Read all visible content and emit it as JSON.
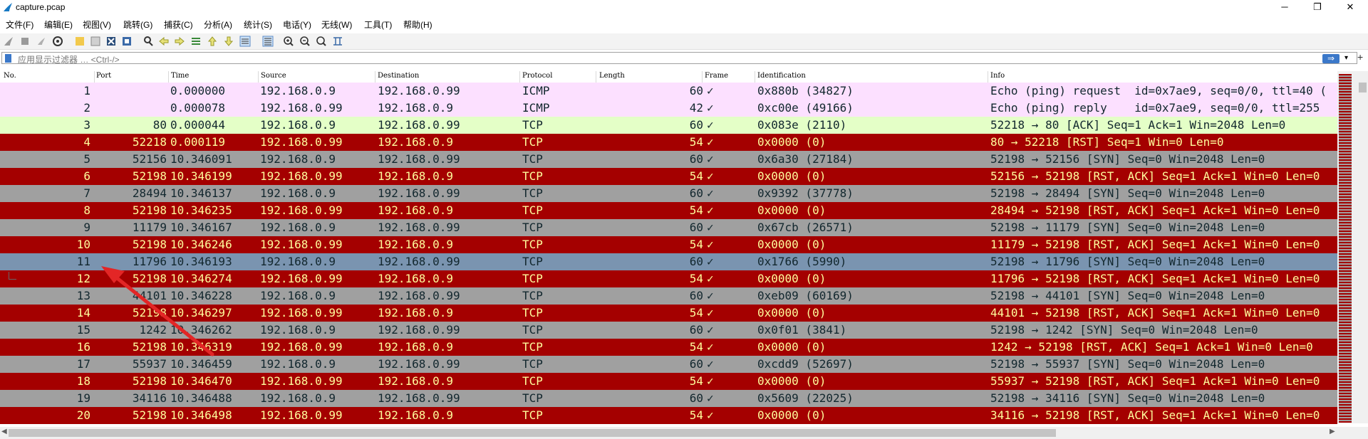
{
  "window": {
    "title": "capture.pcap",
    "minimize": "─",
    "maximize": "❐",
    "close": "✕"
  },
  "menu": [
    "文件(F)",
    "编辑(E)",
    "视图(V)",
    "跳转(G)",
    "捕获(C)",
    "分析(A)",
    "统计(S)",
    "电话(Y)",
    "无线(W)",
    "工具(T)",
    "帮助(H)"
  ],
  "filter": {
    "placeholder": "应用显示过滤器 … <Ctrl-/>",
    "apply": "⇒",
    "dropdown": "▾",
    "add": "+"
  },
  "columns": {
    "no": "No.",
    "port": "Port",
    "time": "Time",
    "source": "Source",
    "destination": "Destination",
    "protocol": "Protocol",
    "length": "Length",
    "frame": "Frame",
    "identification": "Identification",
    "info": "Info"
  },
  "colors": {
    "icmp_bg": "#fce0ff",
    "ack_bg": "#e4ffc7",
    "rst_bg": "#a40000",
    "rst_fg": "#fffc9c",
    "syn_bg": "#a0a0a0",
    "selected_bg": "#7a94b0",
    "arrow": "#e32626"
  },
  "packets": [
    {
      "no": "1",
      "port": "",
      "time": "0.000000",
      "src": "192.168.0.9",
      "dst": "192.168.0.99",
      "proto": "ICMP",
      "len": "60",
      "frame": "✓",
      "id": "0x880b (34827)",
      "info": "Echo (ping) request  id=0x7ae9, seq=0/0, ttl=40 (",
      "style": "icmp"
    },
    {
      "no": "2",
      "port": "",
      "time": "0.000078",
      "src": "192.168.0.99",
      "dst": "192.168.0.9",
      "proto": "ICMP",
      "len": "42",
      "frame": "✓",
      "id": "0xc00e (49166)",
      "info": "Echo (ping) reply    id=0x7ae9, seq=0/0, ttl=255",
      "style": "icmp"
    },
    {
      "no": "3",
      "port": "80",
      "time": "0.000044",
      "src": "192.168.0.9",
      "dst": "192.168.0.99",
      "proto": "TCP",
      "len": "60",
      "frame": "✓",
      "id": "0x083e (2110)",
      "info": "52218 → 80 [ACK] Seq=1 Ack=1 Win=2048 Len=0",
      "style": "ack"
    },
    {
      "no": "4",
      "port": "52218",
      "time": "0.000119",
      "src": "192.168.0.99",
      "dst": "192.168.0.9",
      "proto": "TCP",
      "len": "54",
      "frame": "✓",
      "id": "0x0000 (0)",
      "info": "80 → 52218 [RST] Seq=1 Win=0 Len=0",
      "style": "rst"
    },
    {
      "no": "5",
      "port": "52156",
      "time": "10.346091",
      "src": "192.168.0.9",
      "dst": "192.168.0.99",
      "proto": "TCP",
      "len": "60",
      "frame": "✓",
      "id": "0x6a30 (27184)",
      "info": "52198 → 52156 [SYN] Seq=0 Win=2048 Len=0",
      "style": "syn"
    },
    {
      "no": "6",
      "port": "52198",
      "time": "10.346199",
      "src": "192.168.0.99",
      "dst": "192.168.0.9",
      "proto": "TCP",
      "len": "54",
      "frame": "✓",
      "id": "0x0000 (0)",
      "info": "52156 → 52198 [RST, ACK] Seq=1 Ack=1 Win=0 Len=0",
      "style": "rst"
    },
    {
      "no": "7",
      "port": "28494",
      "time": "10.346137",
      "src": "192.168.0.9",
      "dst": "192.168.0.99",
      "proto": "TCP",
      "len": "60",
      "frame": "✓",
      "id": "0x9392 (37778)",
      "info": "52198 → 28494 [SYN] Seq=0 Win=2048 Len=0",
      "style": "syn"
    },
    {
      "no": "8",
      "port": "52198",
      "time": "10.346235",
      "src": "192.168.0.99",
      "dst": "192.168.0.9",
      "proto": "TCP",
      "len": "54",
      "frame": "✓",
      "id": "0x0000 (0)",
      "info": "28494 → 52198 [RST, ACK] Seq=1 Ack=1 Win=0 Len=0",
      "style": "rst"
    },
    {
      "no": "9",
      "port": "11179",
      "time": "10.346167",
      "src": "192.168.0.9",
      "dst": "192.168.0.99",
      "proto": "TCP",
      "len": "60",
      "frame": "✓",
      "id": "0x67cb (26571)",
      "info": "52198 → 11179 [SYN] Seq=0 Win=2048 Len=0",
      "style": "syn"
    },
    {
      "no": "10",
      "port": "52198",
      "time": "10.346246",
      "src": "192.168.0.99",
      "dst": "192.168.0.9",
      "proto": "TCP",
      "len": "54",
      "frame": "✓",
      "id": "0x0000 (0)",
      "info": "11179 → 52198 [RST, ACK] Seq=1 Ack=1 Win=0 Len=0",
      "style": "rst"
    },
    {
      "no": "11",
      "port": "11796",
      "time": "10.346193",
      "src": "192.168.0.9",
      "dst": "192.168.0.99",
      "proto": "TCP",
      "len": "60",
      "frame": "✓",
      "id": "0x1766 (5990)",
      "info": "52198 → 11796 [SYN] Seq=0 Win=2048 Len=0",
      "style": "selected"
    },
    {
      "no": "12",
      "port": "52198",
      "time": "10.346274",
      "src": "192.168.0.99",
      "dst": "192.168.0.9",
      "proto": "TCP",
      "len": "54",
      "frame": "✓",
      "id": "0x0000 (0)",
      "info": "11796 → 52198 [RST, ACK] Seq=1 Ack=1 Win=0 Len=0",
      "style": "rst"
    },
    {
      "no": "13",
      "port": "44101",
      "time": "10.346228",
      "src": "192.168.0.9",
      "dst": "192.168.0.99",
      "proto": "TCP",
      "len": "60",
      "frame": "✓",
      "id": "0xeb09 (60169)",
      "info": "52198 → 44101 [SYN] Seq=0 Win=2048 Len=0",
      "style": "syn"
    },
    {
      "no": "14",
      "port": "52198",
      "time": "10.346297",
      "src": "192.168.0.99",
      "dst": "192.168.0.9",
      "proto": "TCP",
      "len": "54",
      "frame": "✓",
      "id": "0x0000 (0)",
      "info": "44101 → 52198 [RST, ACK] Seq=1 Ack=1 Win=0 Len=0",
      "style": "rst"
    },
    {
      "no": "15",
      "port": "1242",
      "time": "10.346262",
      "src": "192.168.0.9",
      "dst": "192.168.0.99",
      "proto": "TCP",
      "len": "60",
      "frame": "✓",
      "id": "0x0f01 (3841)",
      "info": "52198 → 1242 [SYN] Seq=0 Win=2048 Len=0",
      "style": "syn"
    },
    {
      "no": "16",
      "port": "52198",
      "time": "10.346319",
      "src": "192.168.0.99",
      "dst": "192.168.0.9",
      "proto": "TCP",
      "len": "54",
      "frame": "✓",
      "id": "0x0000 (0)",
      "info": "1242 → 52198 [RST, ACK] Seq=1 Ack=1 Win=0 Len=0",
      "style": "rst"
    },
    {
      "no": "17",
      "port": "55937",
      "time": "10.346459",
      "src": "192.168.0.9",
      "dst": "192.168.0.99",
      "proto": "TCP",
      "len": "60",
      "frame": "✓",
      "id": "0xcdd9 (52697)",
      "info": "52198 → 55937 [SYN] Seq=0 Win=2048 Len=0",
      "style": "syn"
    },
    {
      "no": "18",
      "port": "52198",
      "time": "10.346470",
      "src": "192.168.0.99",
      "dst": "192.168.0.9",
      "proto": "TCP",
      "len": "54",
      "frame": "✓",
      "id": "0x0000 (0)",
      "info": "55937 → 52198 [RST, ACK] Seq=1 Ack=1 Win=0 Len=0",
      "style": "rst"
    },
    {
      "no": "19",
      "port": "34116",
      "time": "10.346488",
      "src": "192.168.0.9",
      "dst": "192.168.0.99",
      "proto": "TCP",
      "len": "60",
      "frame": "✓",
      "id": "0x5609 (22025)",
      "info": "52198 → 34116 [SYN] Seq=0 Win=2048 Len=0",
      "style": "syn"
    },
    {
      "no": "20",
      "port": "52198",
      "time": "10.346498",
      "src": "192.168.0.99",
      "dst": "192.168.0.9",
      "proto": "TCP",
      "len": "54",
      "frame": "✓",
      "id": "0x0000 (0)",
      "info": "34116 → 52198 [RST, ACK] Seq=1 Ack=1 Win=0 Len=0",
      "style": "rst"
    }
  ]
}
